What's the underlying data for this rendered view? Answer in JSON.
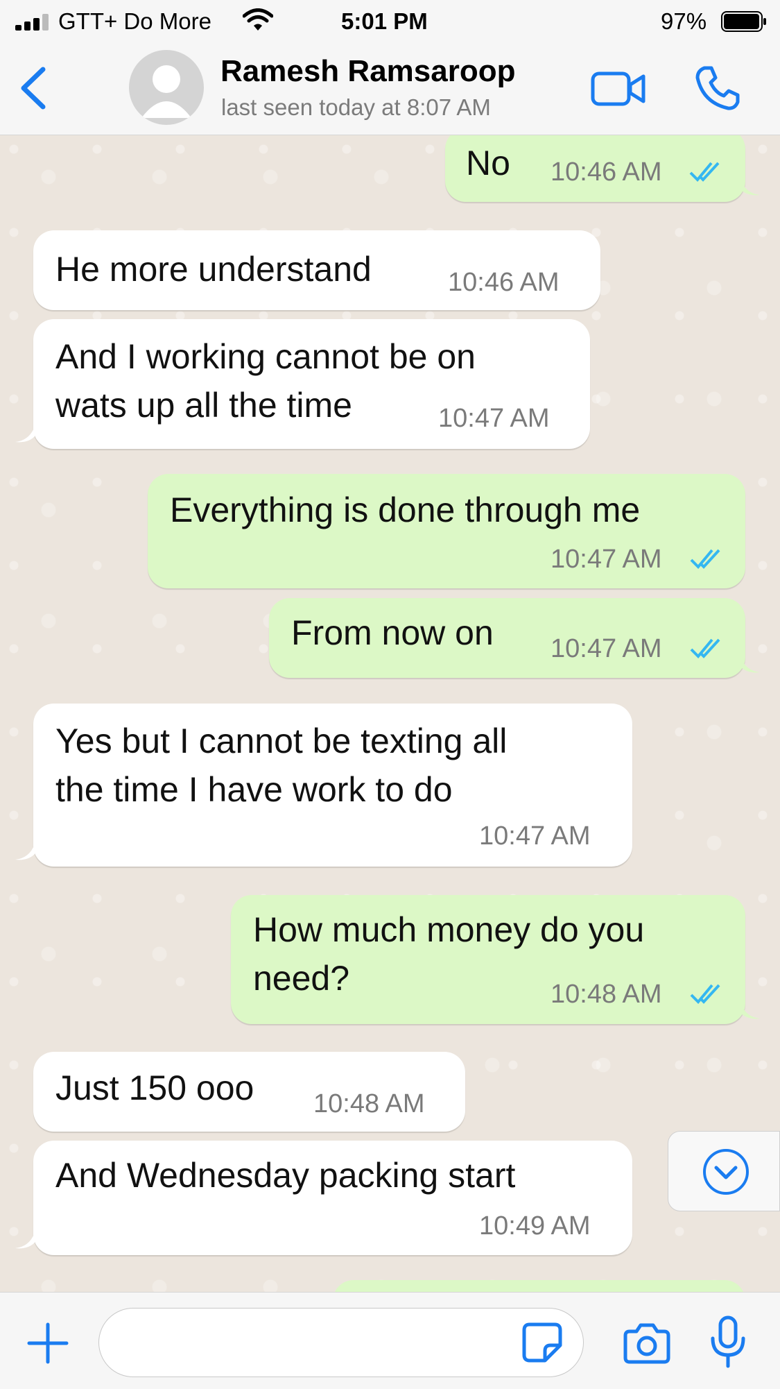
{
  "status_bar": {
    "carrier": "GTT+ Do More",
    "time": "5:01 PM",
    "battery": "97%",
    "icons": [
      "signal-icon",
      "wifi-icon",
      "battery-icon"
    ]
  },
  "header": {
    "contact_name": "Ramesh Ramsaroop",
    "last_seen": "last seen today at 8:07 AM",
    "icons": [
      "back-chevron-icon",
      "avatar-icon",
      "video-camera-icon",
      "phone-icon"
    ],
    "accent_color": "#1a7cf0"
  },
  "messages": [
    {
      "direction": "out",
      "text": "No",
      "time": "10:46 AM",
      "read": true
    },
    {
      "direction": "in",
      "text": "He more understand",
      "time": "10:46 AM"
    },
    {
      "direction": "in",
      "lines": [
        "And I working cannot be on",
        "wats up all the time"
      ],
      "time": "10:47 AM"
    },
    {
      "direction": "out",
      "text": "Everything is done through me",
      "time": "10:47 AM",
      "read": true
    },
    {
      "direction": "out",
      "text": "From now on",
      "time": "10:47 AM",
      "read": true
    },
    {
      "direction": "in",
      "lines": [
        "Yes but I cannot be texting all",
        "the time I have work to do"
      ],
      "time": "10:47 AM"
    },
    {
      "direction": "out",
      "lines": [
        "How much money do you",
        "need?"
      ],
      "time": "10:48 AM",
      "read": true
    },
    {
      "direction": "in",
      "text": "Just 150 ooo",
      "time": "10:48 AM"
    },
    {
      "direction": "in",
      "text": "And Wednesday packing start",
      "time": "10:49 AM"
    }
  ],
  "colors": {
    "incoming_bubble": "#ffffff",
    "outgoing_bubble": "#dcf8c6",
    "read_ticks": "#34b7f1",
    "chat_background": "#ece5dd"
  },
  "input_bar": {
    "message_value": "",
    "icons": [
      "plus-icon",
      "sticker-icon",
      "camera-icon",
      "microphone-icon",
      "scroll-down-chevron-icon"
    ]
  }
}
